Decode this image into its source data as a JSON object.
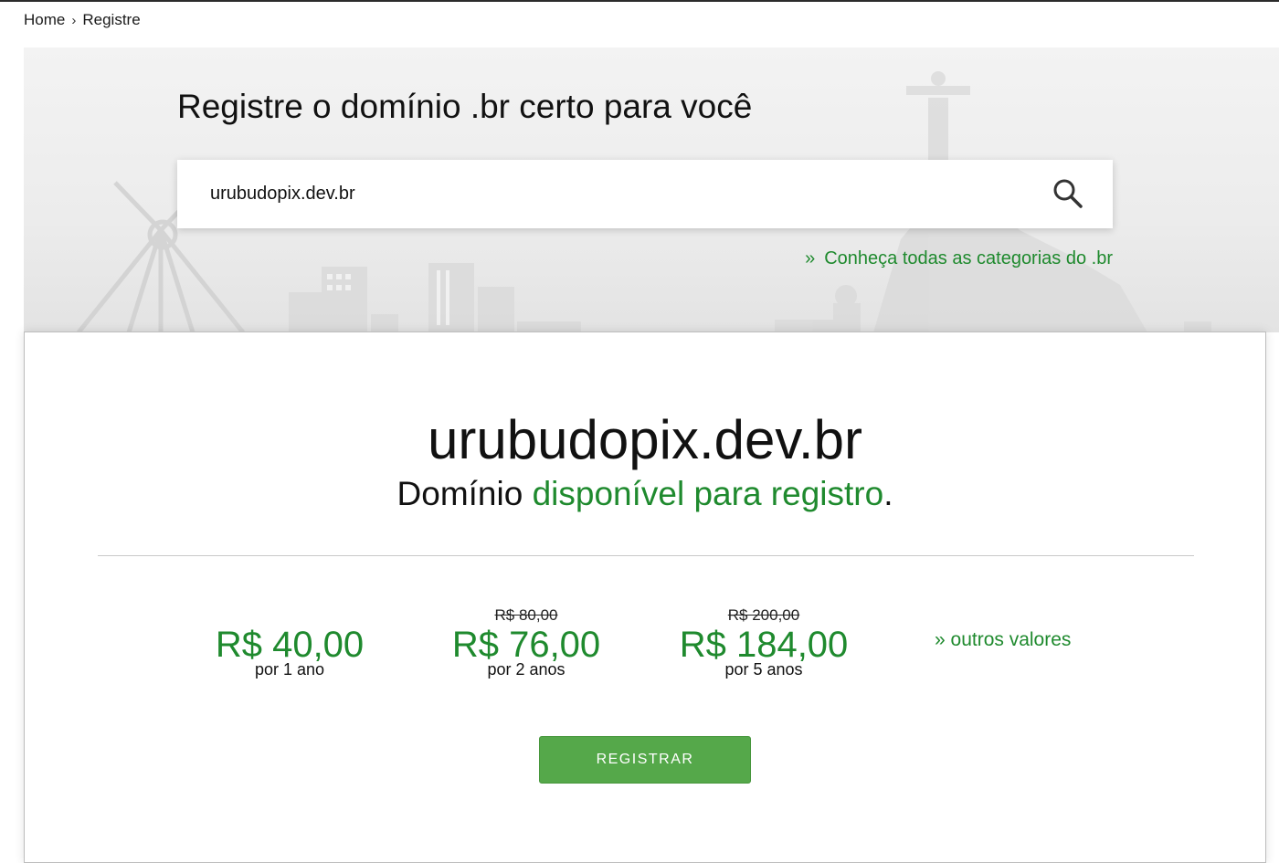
{
  "breadcrumb": {
    "home": "Home",
    "separator": "›",
    "current": "Registre"
  },
  "hero": {
    "title": "Registre o domínio .br certo para você",
    "search_value": "urubudopix.dev.br",
    "search_icon": "search-icon",
    "categories_link": "Conheça todas as categorias do .br",
    "categories_prefix": "»"
  },
  "result": {
    "domain": "urubudopix.dev.br",
    "status_prefix": "Domínio ",
    "status_highlight": "disponível para registro",
    "status_suffix": ".",
    "prices": [
      {
        "old": "",
        "value": "R$ 40,00",
        "period": "por 1 ano"
      },
      {
        "old": "R$ 80,00",
        "value": "R$ 76,00",
        "period": "por 2 anos"
      },
      {
        "old": "R$ 200,00",
        "value": "R$ 184,00",
        "period": "por 5 anos"
      }
    ],
    "other_values": "» outros valores",
    "register_button": "REGISTRAR"
  },
  "colors": {
    "accent_green": "#1f8a2e",
    "button_green": "#55a84a"
  }
}
